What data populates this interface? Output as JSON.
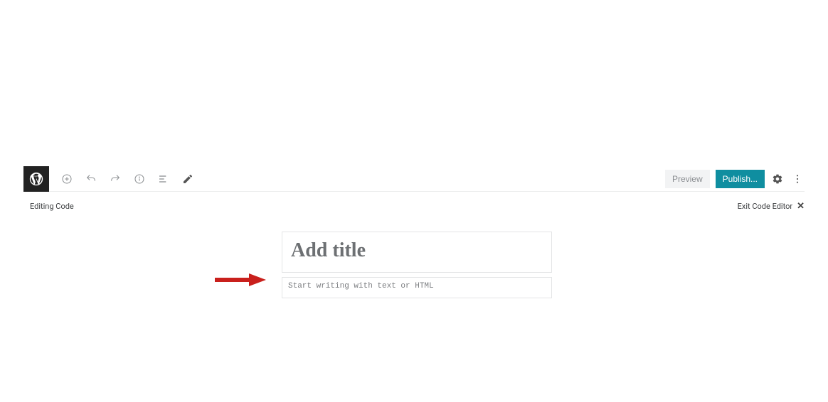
{
  "toolbar": {
    "preview_label": "Preview",
    "publish_label": "Publish..."
  },
  "status": {
    "mode_label": "Editing Code",
    "exit_label": "Exit Code Editor"
  },
  "editor": {
    "title_placeholder": "Add title",
    "title_value": "",
    "content_placeholder": "Start writing with text or HTML",
    "content_value": ""
  }
}
